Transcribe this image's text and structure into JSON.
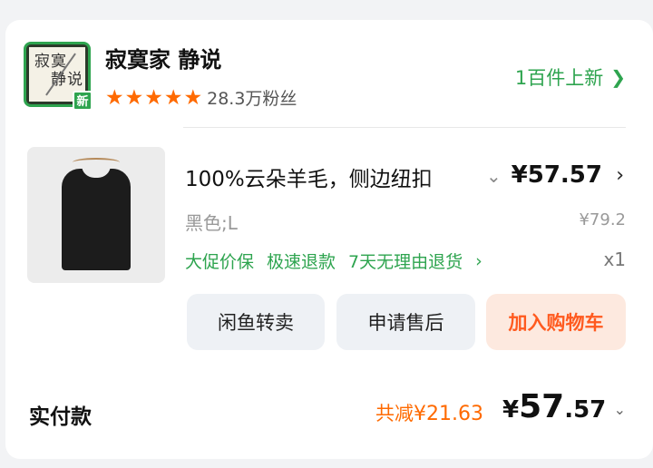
{
  "shop": {
    "logo_text_line1": "寂寞",
    "logo_text_line2": "静说",
    "new_badge": "新",
    "name": "寂寞家 静说",
    "star_count": 5,
    "fans": "28.3万粉丝",
    "new_items": "1百件上新",
    "accent_color": "#2ea44f"
  },
  "product": {
    "title": "100%云朵羊毛，侧边纽扣",
    "price": "¥57.57",
    "spec": "黑色;L",
    "original_price": "¥79.2",
    "services": [
      "大促价保",
      "极速退款",
      "7天无理由退货"
    ],
    "quantity": "x1"
  },
  "actions": {
    "resell": "闲鱼转卖",
    "after_sale": "申请售后",
    "add_to_cart": "加入购物车"
  },
  "footer": {
    "paid_label": "实付款",
    "discount_label": "共减",
    "discount_value": "¥21.63",
    "total_yen": "¥",
    "total_int": "57",
    "total_dec": ".57"
  }
}
